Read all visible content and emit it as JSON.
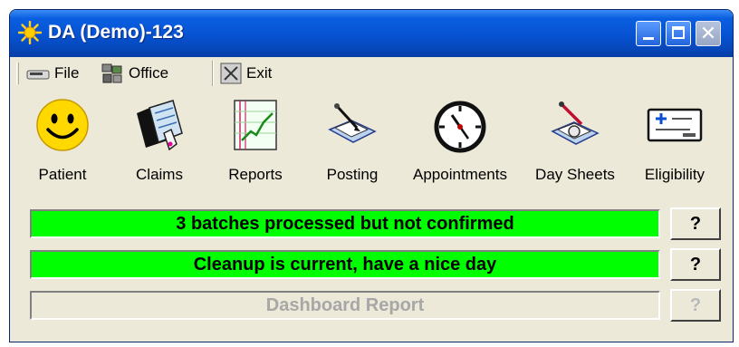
{
  "window": {
    "title": "DA (Demo)-123",
    "icon": "sun-icon",
    "controls": [
      "minimize-icon",
      "maximize-icon",
      "close-icon"
    ],
    "close_glyph": "✕"
  },
  "menu": [
    {
      "label": "File",
      "icon": "file-icon"
    },
    {
      "label": "Office",
      "icon": "office-icon"
    },
    {
      "label": "Exit",
      "icon": "exit-icon"
    }
  ],
  "toolbar": [
    {
      "label": "Patient",
      "icon": "smiley-icon"
    },
    {
      "label": "Claims",
      "icon": "claims-icon"
    },
    {
      "label": "Reports",
      "icon": "chart-icon"
    },
    {
      "label": "Posting",
      "icon": "posting-icon"
    },
    {
      "label": "Appointments",
      "icon": "clock-icon"
    },
    {
      "label": "Day Sheets",
      "icon": "daysheets-icon"
    },
    {
      "label": "Eligibility",
      "icon": "eligibility-card-icon"
    }
  ],
  "status": [
    {
      "text": "3 batches processed but not confirmed",
      "help": "?",
      "color": "#00ff00",
      "enabled": true
    },
    {
      "text": "Cleanup is current, have a nice day",
      "help": "?",
      "color": "#00ff00",
      "enabled": true
    },
    {
      "text": "Dashboard Report",
      "help": "?",
      "color": "#ece9d8",
      "enabled": false
    }
  ],
  "colors": {
    "titlebar": "#0754d4",
    "status_ok": "#00ff00",
    "panel": "#ece9d8"
  }
}
